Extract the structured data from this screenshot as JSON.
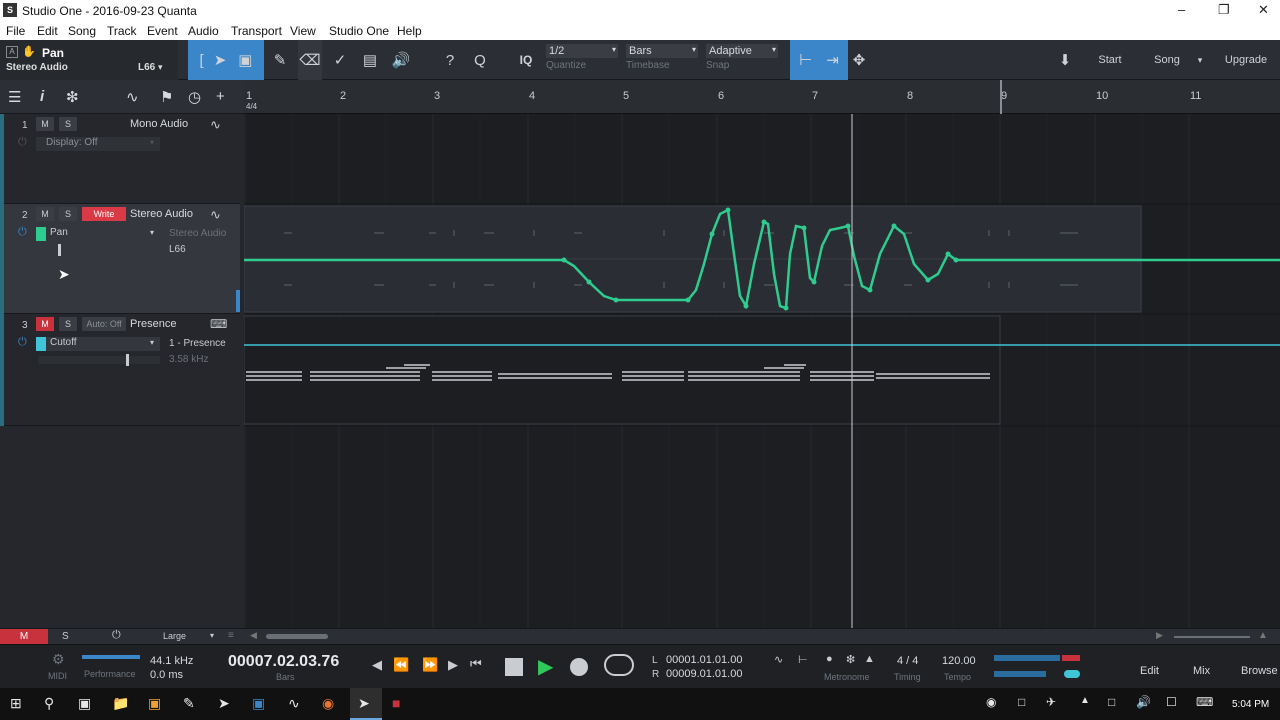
{
  "window": {
    "title": "Studio One - 2016-09-23 Quanta",
    "app_icon_text": "S"
  },
  "menu": [
    "File",
    "Edit",
    "Song",
    "Track",
    "Event",
    "Audio",
    "Transport",
    "View",
    "Studio One",
    "Help"
  ],
  "toolbar": {
    "track_name": "Pan",
    "track_type": "Stereo Audio",
    "pan_value": "L66",
    "quantize_value": "1/2",
    "quantize_label": "Quantize",
    "timebase_value": "Bars",
    "timebase_label": "Timebase",
    "snap_value": "Adaptive",
    "snap_label": "Snap",
    "iq_label": "IQ",
    "start_label": "Start",
    "song_label": "Song",
    "upgrade_label": "Upgrade"
  },
  "ruler": {
    "bars": [
      "1",
      "2",
      "3",
      "4",
      "5",
      "6",
      "7",
      "8",
      "9",
      "10",
      "11"
    ],
    "time_signature": "4/4"
  },
  "tracks": [
    {
      "number": "1",
      "mute": "M",
      "solo": "S",
      "name": "Mono Audio",
      "param": "Display: Off"
    },
    {
      "number": "2",
      "mute": "M",
      "solo": "S",
      "auto_mode": "Write",
      "name": "Stereo Audio",
      "param": "Pan",
      "sub_name": "Stereo Audio",
      "value": "L66"
    },
    {
      "number": "3",
      "mute": "M",
      "solo": "S",
      "auto_mode": "Auto: Off",
      "name": "Presence",
      "param": "Cutoff",
      "sub_name": "1 - Presence",
      "value": "3.58 kHz"
    }
  ],
  "bottom": {
    "mute": "M",
    "solo": "S",
    "size": "Large"
  },
  "transport": {
    "sample_rate": "44.1 kHz",
    "latency": "0.0 ms",
    "midi_label": "MIDI",
    "perf_label": "Performance",
    "position": "00007.02.03.76",
    "position_unit": "Bars",
    "left_locator": "00001.01.01.00",
    "right_locator": "00009.01.01.00",
    "l_label": "L",
    "r_label": "R",
    "metronome_label": "Metronome",
    "timing_value": "4 / 4",
    "timing_label": "Timing",
    "tempo_value": "120.00",
    "tempo_label": "Tempo",
    "edit_label": "Edit",
    "mix_label": "Mix",
    "browse_label": "Browse"
  },
  "taskbar": {
    "clock": "5:04 PM"
  },
  "colors": {
    "accent": "#3a86c8",
    "automation_green": "#2ecc8f",
    "automation_cyan": "#3fc4d8",
    "write_red": "#d93a45",
    "mute_red": "#c8323c"
  }
}
